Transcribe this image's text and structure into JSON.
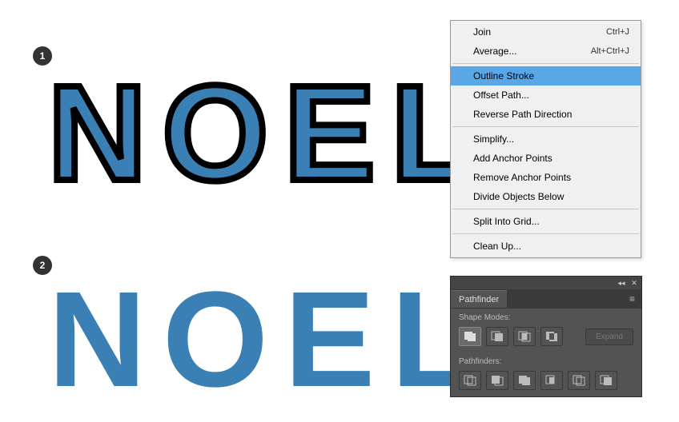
{
  "steps": {
    "one": "1",
    "two": "2"
  },
  "artwork": {
    "text1": "NOEL",
    "text2": "NOEL",
    "color": "#3a80b4"
  },
  "menu": {
    "groups": [
      [
        {
          "label": "Join",
          "shortcut": "Ctrl+J"
        },
        {
          "label": "Average...",
          "shortcut": "Alt+Ctrl+J"
        }
      ],
      [
        {
          "label": "Outline Stroke",
          "shortcut": "",
          "selected": true
        },
        {
          "label": "Offset Path...",
          "shortcut": ""
        },
        {
          "label": "Reverse Path Direction",
          "shortcut": ""
        }
      ],
      [
        {
          "label": "Simplify...",
          "shortcut": ""
        },
        {
          "label": "Add Anchor Points",
          "shortcut": ""
        },
        {
          "label": "Remove Anchor Points",
          "shortcut": ""
        },
        {
          "label": "Divide Objects Below",
          "shortcut": ""
        }
      ],
      [
        {
          "label": "Split Into Grid...",
          "shortcut": ""
        }
      ],
      [
        {
          "label": "Clean Up...",
          "shortcut": ""
        }
      ]
    ]
  },
  "panel": {
    "title": "Pathfinder",
    "sections": {
      "shape_modes": {
        "label": "Shape Modes:",
        "buttons": [
          "unite",
          "minus-front",
          "intersect",
          "exclude"
        ],
        "expand_label": "Expand"
      },
      "pathfinders": {
        "label": "Pathfinders:",
        "buttons": [
          "divide",
          "trim",
          "merge",
          "crop",
          "outline",
          "minus-back"
        ]
      }
    }
  }
}
